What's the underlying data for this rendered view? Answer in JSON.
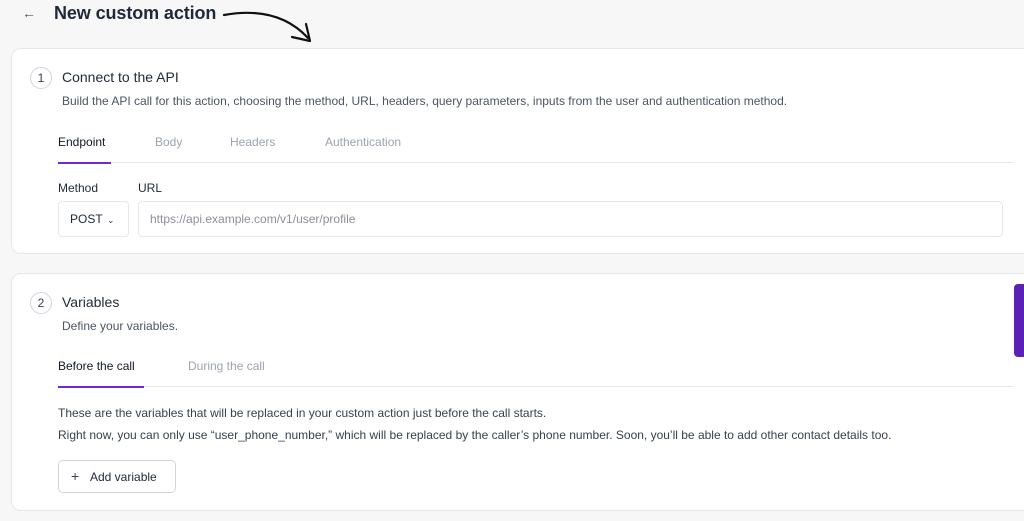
{
  "header": {
    "back_icon": "arrow-left-icon",
    "title": "New custom action"
  },
  "step1": {
    "number": "1",
    "title": "Connect to the API",
    "description": "Build the API call for this action, choosing the method, URL, headers, query parameters, inputs from the user and authentication method.",
    "tabs": [
      "Endpoint",
      "Body",
      "Headers",
      "Authentication"
    ],
    "active_tab": "Endpoint",
    "method_label": "Method",
    "method_value": "POST",
    "url_label": "URL",
    "url_placeholder": "https://api.example.com/v1/user/profile",
    "url_value": ""
  },
  "step2": {
    "number": "2",
    "title": "Variables",
    "description": "Define your variables.",
    "tabs": [
      "Before the call",
      "During the call"
    ],
    "active_tab": "Before the call",
    "info_line1": "These are the variables that will be replaced in your custom action just before the call starts.",
    "info_line2": "Right now, you can only use “user_phone_number,” which will be replaced by the caller’s phone number. Soon, you’ll be able to add other contact details too.",
    "add_button": "Add variable",
    "add_icon": "plus-icon"
  },
  "colors": {
    "accent": "#6d28d9",
    "scrollbar": "#5b21b6",
    "background": "#f7f7f8",
    "card": "#ffffff"
  }
}
